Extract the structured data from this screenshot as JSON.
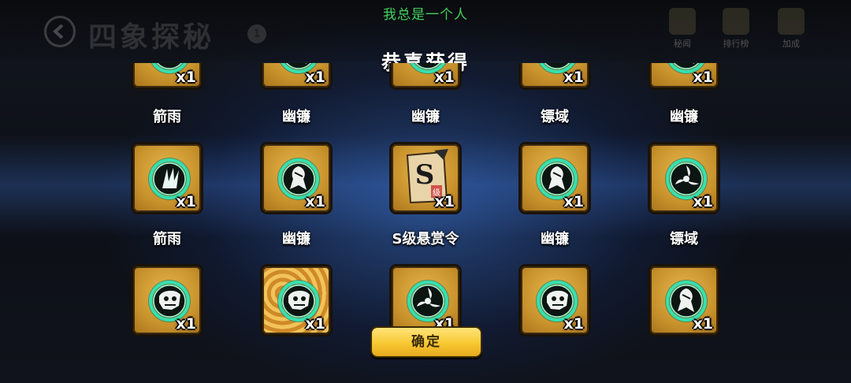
{
  "background": {
    "title": "四象探秘",
    "badge": "1",
    "top_icons": [
      "秘闻",
      "排行榜",
      "加成"
    ]
  },
  "player_name": "我总是一个人",
  "dialog_title": "恭喜获得",
  "rows": [
    {
      "items": [
        {
          "emblem": "blade-rain-emblem",
          "qty": "x1"
        },
        {
          "emblem": "ghost-scythe-emblem",
          "qty": "x1"
        },
        {
          "emblem": "ghost-scythe-emblem",
          "qty": "x1"
        },
        {
          "emblem": "dart-domain-emblem",
          "qty": "x1"
        },
        {
          "emblem": "ghost-scythe-emblem",
          "qty": "x1"
        }
      ],
      "names": [
        "箭雨",
        "幽镰",
        "幽镰",
        "镖域",
        "幽镰"
      ]
    },
    {
      "items": [
        {
          "emblem": "blade-rain-emblem",
          "qty": "x1"
        },
        {
          "emblem": "ghost-scythe-emblem",
          "qty": "x1"
        },
        {
          "emblem": "bounty-scroll-icon",
          "qty": "x1",
          "scroll_letter": "S",
          "scroll_stamp": "级"
        },
        {
          "emblem": "ghost-scythe-emblem",
          "qty": "x1"
        },
        {
          "emblem": "dart-domain-emblem",
          "qty": "x1"
        }
      ],
      "names": [
        "箭雨",
        "幽镰",
        "S级悬赏令",
        "幽镰",
        "镖域"
      ]
    },
    {
      "items": [
        {
          "emblem": "skull-beast-emblem",
          "qty": "x1"
        },
        {
          "emblem": "skull-beast-emblem",
          "qty": "x1"
        },
        {
          "emblem": "dart-domain-emblem",
          "qty": "x1"
        },
        {
          "emblem": "skull-beast-emblem",
          "qty": "x1"
        },
        {
          "emblem": "ghost-scythe-emblem",
          "qty": "x1"
        }
      ]
    }
  ],
  "confirm_label": "确定",
  "colors": {
    "player_name": "#44d15a",
    "button": "#f7c832",
    "slot": "#c8922c",
    "ring": "#35e0b0"
  }
}
